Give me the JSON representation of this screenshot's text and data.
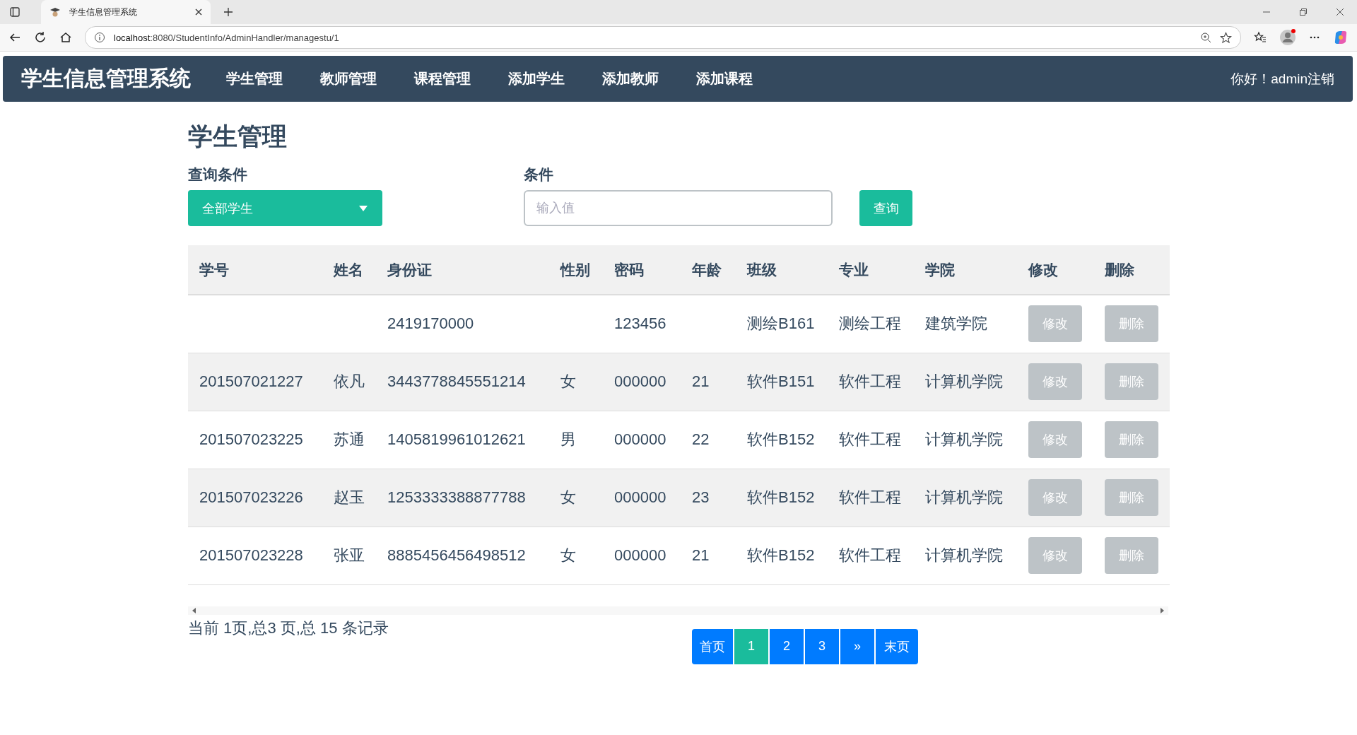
{
  "browser": {
    "tab_title": "学生信息管理系统",
    "url_host": "localhost",
    "url_rest": ":8080/StudentInfo/AdminHandler/managestu/1"
  },
  "navbar": {
    "brand": "学生信息管理系统",
    "items": [
      {
        "label": "学生管理"
      },
      {
        "label": "教师管理"
      },
      {
        "label": "课程管理"
      },
      {
        "label": "添加学生"
      },
      {
        "label": "添加教师"
      },
      {
        "label": "添加课程"
      }
    ],
    "greeting": "你好！admin",
    "logout": "注销"
  },
  "page_title": "学生管理",
  "filter": {
    "select_label": "查询条件",
    "select_value": "全部学生",
    "input_label": "条件",
    "input_placeholder": "输入值",
    "search_button": "查询"
  },
  "table": {
    "columns": [
      "学号",
      "姓名",
      "身份证",
      "性别",
      "密码",
      "年龄",
      "班级",
      "专业",
      "学院",
      "修改",
      "删除"
    ],
    "rows": [
      {
        "idcard": "2419170000",
        "password": "123456",
        "class": "测绘B161",
        "major": "测绘工程",
        "college": "建筑学院",
        "edit": "修改",
        "delete": "删除"
      },
      {
        "id": "201507021227",
        "name": "依凡",
        "idcard": "3443778845551214",
        "gender": "女",
        "password": "000000",
        "age": "21",
        "class": "软件B151",
        "major": "软件工程",
        "college": "计算机学院",
        "edit": "修改",
        "delete": "删除"
      },
      {
        "id": "201507023225",
        "name": "苏通",
        "idcard": "1405819961012621",
        "gender": "男",
        "password": "000000",
        "age": "22",
        "class": "软件B152",
        "major": "软件工程",
        "college": "计算机学院",
        "edit": "修改",
        "delete": "删除"
      },
      {
        "id": "201507023226",
        "name": "赵玉",
        "idcard": "1253333388877788",
        "gender": "女",
        "password": "000000",
        "age": "23",
        "class": "软件B152",
        "major": "软件工程",
        "college": "计算机学院",
        "edit": "修改",
        "delete": "删除"
      },
      {
        "id": "201507023228",
        "name": "张亚",
        "idcard": "8885456456498512",
        "gender": "女",
        "password": "000000",
        "age": "21",
        "class": "软件B152",
        "major": "软件工程",
        "college": "计算机学院",
        "edit": "修改",
        "delete": "删除"
      }
    ]
  },
  "summary": "当前 1页,总3 页,总 15 条记录",
  "pagination": [
    {
      "label": "首页",
      "selected": false
    },
    {
      "label": "1",
      "selected": true
    },
    {
      "label": "2",
      "selected": false
    },
    {
      "label": "3",
      "selected": false
    },
    {
      "label": "»",
      "selected": false
    },
    {
      "label": "末页",
      "selected": false
    }
  ]
}
